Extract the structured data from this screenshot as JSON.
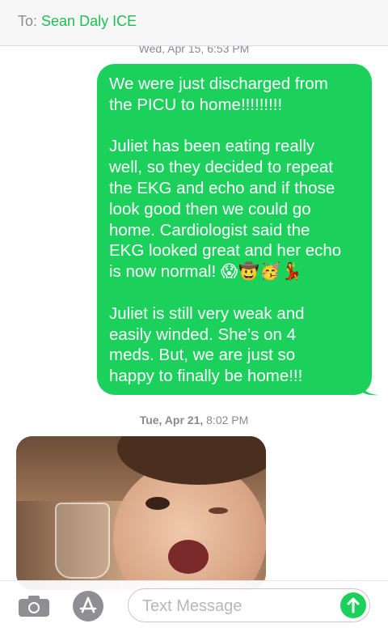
{
  "header": {
    "to_prefix": "To:",
    "contact_name": "Sean Daly ICE"
  },
  "messages": {
    "timestamp_top": "Wed, Apr 15, 6:53 PM",
    "sent_paragraph_1": "We were just discharged from\nthe PICU to home!!!!!!!!!",
    "sent_paragraph_2": "Juliet has been eating really\nwell, so they decided to repeat\nthe EKG and echo and if those\nlook good then we could go\nhome. Cardiologist said the\nEKG looked great and her echo\nis now normal!",
    "sent_emojis": "😱🤠🥳💃",
    "sent_paragraph_3": "Juliet is still very weak and\neasily winded. She’s on 4\nmeds. But, we are just so\nhappy to finally be home!!!",
    "timestamp_day": "Tue, Apr 21,",
    "timestamp_time": "8:02 PM"
  },
  "composer": {
    "placeholder": "Text Message"
  },
  "colors": {
    "sent_bubble": "#1cd05c",
    "accent": "#1ebe50",
    "meta_gray": "#8a8a8f"
  }
}
